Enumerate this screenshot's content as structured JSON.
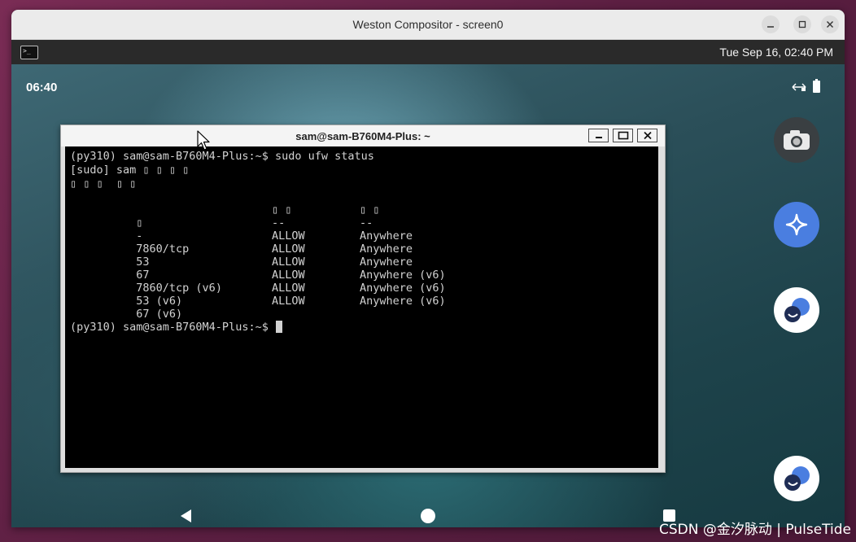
{
  "weston": {
    "title": "Weston Compositor - screen0",
    "clock": "Tue Sep 16, 02:40 PM"
  },
  "android": {
    "status_time": "06:40",
    "dock": [
      "camera-icon",
      "assistant-icon",
      "app-icon",
      "app-icon"
    ]
  },
  "xterm": {
    "title": "sam@sam-B760M4-Plus: ~",
    "lines": [
      "(py310) sam@sam-B760M4-Plus:~$ sudo ufw status",
      "[sudo] sam ▯ ▯ ▯ ▯",
      "▯ ▯ ▯  ▯ ▯",
      "",
      "▯",
      "-",
      "7860/tcp",
      "53",
      "67",
      "7860/tcp (v6)",
      "53 (v6)",
      "67 (v6)",
      "",
      "(py310) sam@sam-B760M4-Plus:~$ "
    ],
    "table": {
      "header_col2": "▯ ▯",
      "header_col3": "▯ ▯",
      "rule_col2": "--",
      "rule_col3": "--",
      "rows": [
        {
          "action": "ALLOW",
          "from": "Anywhere"
        },
        {
          "action": "ALLOW",
          "from": "Anywhere"
        },
        {
          "action": "ALLOW",
          "from": "Anywhere"
        },
        {
          "action": "ALLOW",
          "from": "Anywhere (v6)"
        },
        {
          "action": "ALLOW",
          "from": "Anywhere (v6)"
        },
        {
          "action": "ALLOW",
          "from": "Anywhere (v6)"
        }
      ]
    }
  },
  "watermark": "CSDN @金汐脉动 | PulseTide"
}
